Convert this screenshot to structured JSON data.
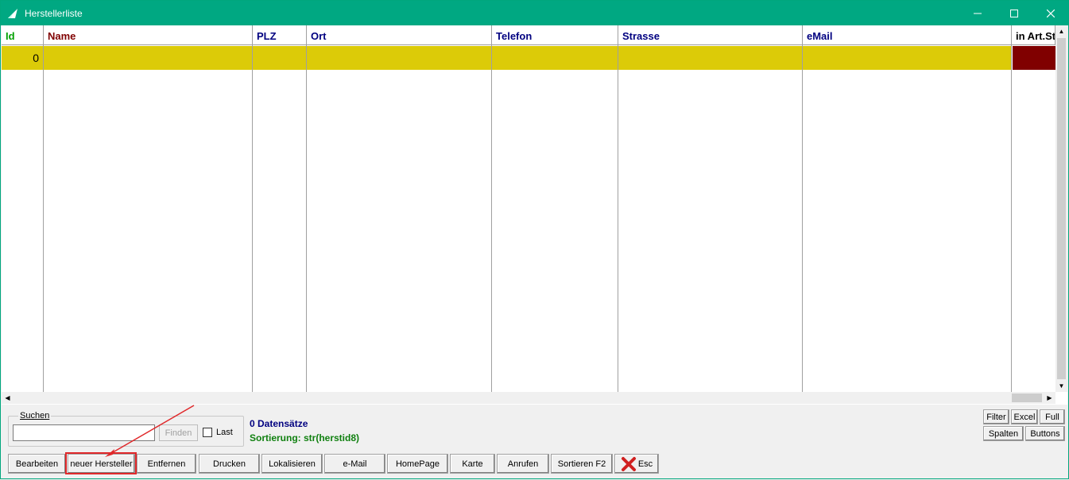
{
  "window": {
    "title": "Herstellerliste",
    "minimize_icon": "minimize-icon",
    "maximize_icon": "maximize-icon",
    "close_icon": "close-icon"
  },
  "grid": {
    "columns": [
      "Id",
      "Name",
      "PLZ",
      "Ort",
      "Telefon",
      "Strasse",
      "eMail",
      "in Art.St"
    ],
    "column_colors": [
      "#00a000",
      "#800000",
      "#000080",
      "#000080",
      "#000080",
      "#000080",
      "#000080",
      "#000000"
    ],
    "rows": [
      {
        "id": "0",
        "name": "",
        "plz": "",
        "ort": "",
        "telefon": "",
        "strasse": "",
        "email": "",
        "in_art": ""
      }
    ],
    "selected_row_color": "#dccb08",
    "flag_cell_color": "#800000"
  },
  "search": {
    "group_label": "Suchen",
    "input_value": "",
    "find_label": "Finden",
    "last_label": "Last",
    "last_checked": false
  },
  "status": {
    "count_text": "0 Datensätze",
    "sort_text": "Sortierung: str(herstid8)"
  },
  "side_buttons": {
    "filter": "Filter",
    "excel": "Excel",
    "full": "Full",
    "spalten": "Spalten",
    "buttons": "Buttons"
  },
  "toolbar": {
    "bearbeiten": "Bearbeiten",
    "neuer_hersteller": "neuer Hersteller",
    "entfernen": "Entfernen",
    "drucken": "Drucken",
    "lokalisieren": "Lokalisieren",
    "email": "e-Mail",
    "homepage": "HomePage",
    "karte": "Karte",
    "anrufen": "Anrufen",
    "sortieren": "Sortieren F2",
    "esc": "Esc"
  },
  "annotation": {
    "highlight_color": "#e0282a",
    "highlighted_button": "neuer Hersteller"
  }
}
